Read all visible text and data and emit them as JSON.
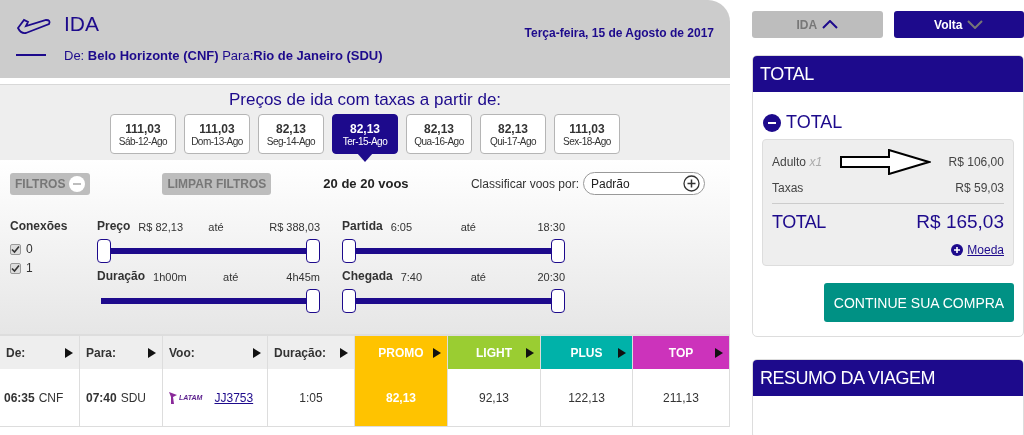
{
  "header": {
    "title": "IDA",
    "route": "De: **Belo Horizonte (CNF)** Para:**Rio de Janeiro (SDU)**",
    "date": "Terça-feira, 15 de Agosto de 2017"
  },
  "price_strip": {
    "title": "Preços de ida com taxas a partir de:",
    "days": [
      {
        "price": "111,03",
        "date": "Sáb-12-Ago",
        "selected": false
      },
      {
        "price": "111,03",
        "date": "Dom-13-Ago",
        "selected": false
      },
      {
        "price": "82,13",
        "date": "Seg-14-Ago",
        "selected": false
      },
      {
        "price": "82,13",
        "date": "Ter-15-Ago",
        "selected": true
      },
      {
        "price": "82,13",
        "date": "Qua-16-Ago",
        "selected": false
      },
      {
        "price": "82,13",
        "date": "Qui-17-Ago",
        "selected": false
      },
      {
        "price": "111,03",
        "date": "Sex-18-Ago",
        "selected": false
      }
    ]
  },
  "filters": {
    "toggle": "FILTROS",
    "clear": "LIMPAR FILTROS",
    "count": "20 de 20 voos",
    "sort_label": "Classificar voos por:",
    "sort_value": "Padrão",
    "connections": {
      "title": "Conexões",
      "options": [
        {
          "label": "0",
          "checked": true
        },
        {
          "label": "1",
          "checked": true
        }
      ]
    },
    "ranges": [
      {
        "label": "Preço",
        "from": "R$ 82,13",
        "word": "até",
        "to": "R$ 388,03",
        "thumbs": [
          {
            "level": 0
          },
          {
            "level": 1
          }
        ]
      },
      {
        "label": "Partida",
        "from": "6:05",
        "word": "até",
        "to": "18:30",
        "thumbs": [
          {
            "level": 0
          },
          {
            "level": 1
          }
        ]
      },
      {
        "label": "Duração",
        "from": "1h00m",
        "word": "até",
        "to": "4h45m",
        "thumbs": [
          {
            "level": 1
          }
        ]
      },
      {
        "label": "Chegada",
        "from": "7:40",
        "word": "até",
        "to": "20:30",
        "thumbs": [
          {
            "level": 0
          },
          {
            "level": 1
          }
        ]
      }
    ]
  },
  "table": {
    "columns": [
      {
        "kind": "plain",
        "label": "De:"
      },
      {
        "kind": "plain",
        "label": "Para:"
      },
      {
        "kind": "plain",
        "label": "Voo:"
      },
      {
        "kind": "plain",
        "label": "Duração:"
      },
      {
        "kind": "fare",
        "label": "PROMO",
        "color": "#ffc300"
      },
      {
        "kind": "fare",
        "label": "LIGHT",
        "color": "#9acd32"
      },
      {
        "kind": "fare",
        "label": "PLUS",
        "color": "#00b2a9"
      },
      {
        "kind": "fare",
        "label": "TOP",
        "color": "#cc33bb"
      }
    ],
    "rows": [
      {
        "departure_time": "06:35",
        "departure_airport": "CNF",
        "arrival_time": "07:40",
        "arrival_airport": "SDU",
        "airline": "LATAM",
        "flight": "JJ3753",
        "duration": "1:05",
        "fares": [
          {
            "price": "82,13",
            "selected": true
          },
          {
            "price": "92,13",
            "selected": false
          },
          {
            "price": "122,13",
            "selected": false
          },
          {
            "price": "211,13",
            "selected": false
          }
        ]
      }
    ]
  },
  "legs": [
    {
      "label": "IDA",
      "expanded": true
    },
    {
      "label": "Volta",
      "expanded": false
    }
  ],
  "total_card": {
    "title": "TOTAL",
    "section": "TOTAL",
    "lines": [
      {
        "label": "Adulto",
        "qty": "x1",
        "amount": "R$ 106,00"
      },
      {
        "label": "Taxas",
        "amount": "R$ 59,03"
      }
    ],
    "total_label": "TOTAL",
    "total": "R$ 165,03",
    "currency_link": "Moeda",
    "button": "CONTINUE SUA COMPRA"
  },
  "summary_card": {
    "title": "RESUMO DA VIAGEM"
  }
}
